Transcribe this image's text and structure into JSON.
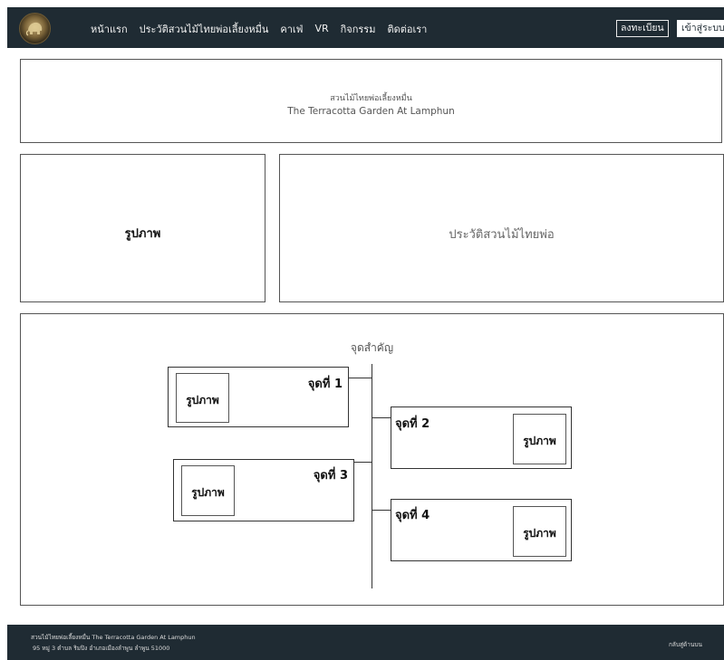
{
  "nav": {
    "logo_alt": "logo",
    "links": [
      "หน้าแรก",
      "ประวัติสวนไม้ไทยพ่อเลี้ยงหมื่น",
      "คาเฟ่",
      "VR",
      "กิจกรรม",
      "ติดต่อเรา"
    ],
    "register_label": "ลงทะเบียน",
    "login_label": "เข้าสู่ระบบ"
  },
  "banner": {
    "title_thai": "สวนไม้ไทยพ่อเลี้ยงหมื่น",
    "title_en": "The Terracotta Garden At Lamphun"
  },
  "row2": {
    "image_label": "รูปภาพ",
    "history_label": "ประวัติสวนไม้ไทยพ่อ"
  },
  "highlights": {
    "title": "จุดสำคัญ",
    "spots": [
      {
        "label": "จุดที่ 1",
        "image_label": "รูปภาพ"
      },
      {
        "label": "จุดที่ 2",
        "image_label": "รูปภาพ"
      },
      {
        "label": "จุดที่ 3",
        "image_label": "รูปภาพ"
      },
      {
        "label": "จุดที่ 4",
        "image_label": "รูปภาพ"
      }
    ]
  },
  "footer": {
    "line1": "สวนไม้ไทยพ่อเลี้ยงหมื่น The Terracotta Garden At Lamphun",
    "line2": "95 หมู่ 3 ตำบล ริมปิง อำเภอเมืองลำพูน ลำพูน 51000",
    "back_to_top": "กลับสู่ด้านบน"
  },
  "colors": {
    "nav_bg": "#1f2b33",
    "footer_bg": "#1f2b33",
    "border": "#555555"
  }
}
